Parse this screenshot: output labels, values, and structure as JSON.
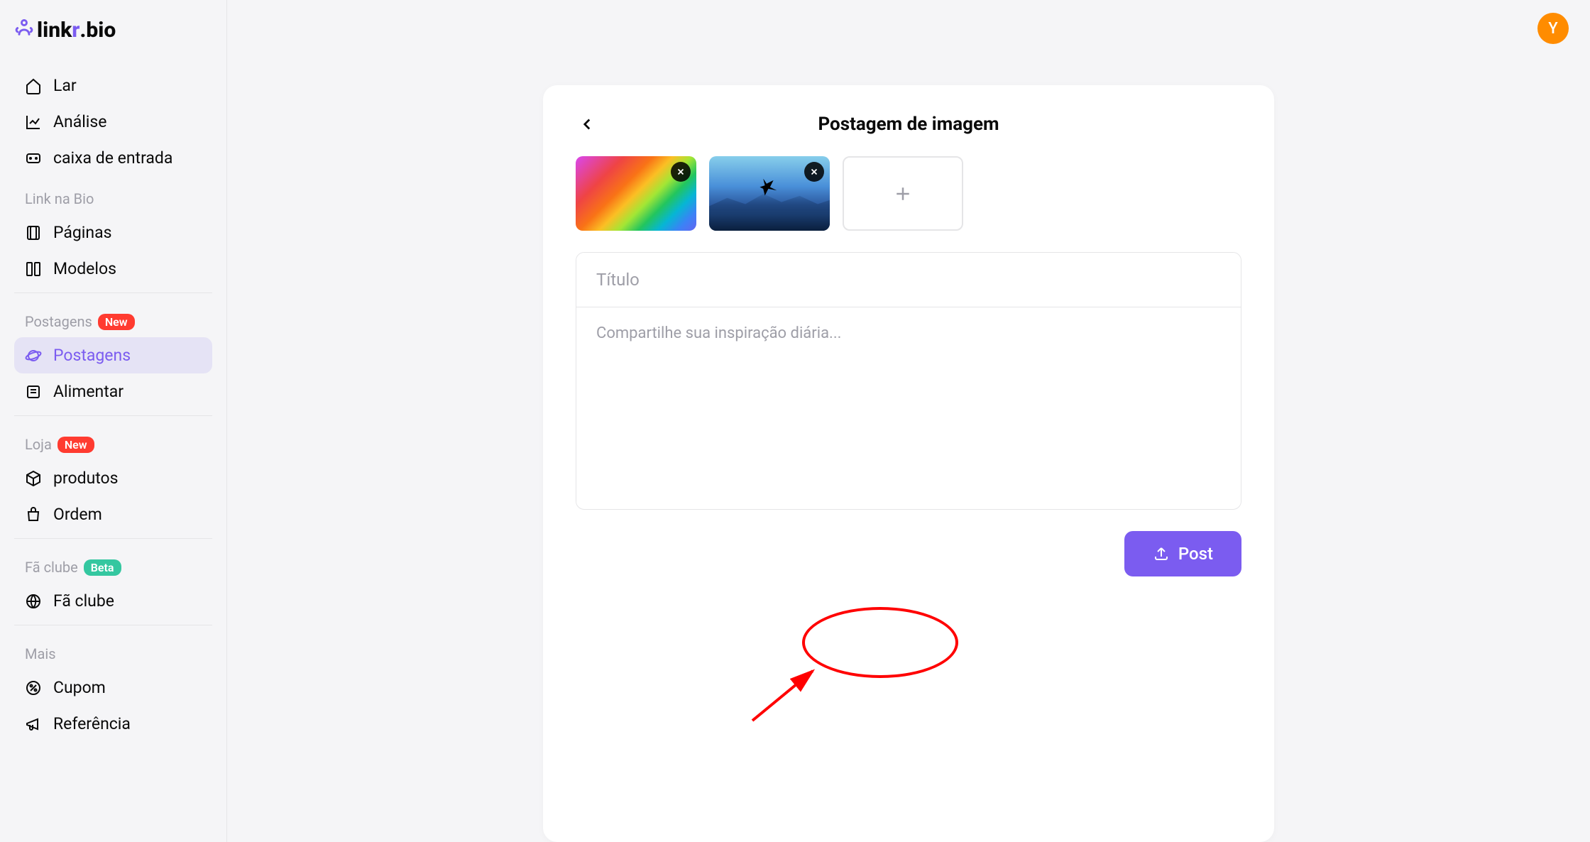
{
  "logo": {
    "text_black1": "link",
    "text_purple": "r",
    "text_black2": ".bio"
  },
  "avatar": {
    "initial": "Y"
  },
  "sidebar": {
    "top": [
      {
        "label": "Lar",
        "icon": "home"
      },
      {
        "label": "Análise",
        "icon": "chart"
      },
      {
        "label": "caixa de entrada",
        "icon": "inbox"
      }
    ],
    "sections": [
      {
        "title": "Link na Bio",
        "badge": null,
        "items": [
          {
            "label": "Páginas",
            "icon": "pages"
          },
          {
            "label": "Modelos",
            "icon": "models"
          }
        ]
      },
      {
        "title": "Postagens",
        "badge": "New",
        "badge_type": "new",
        "items": [
          {
            "label": "Postagens",
            "icon": "planet",
            "active": true
          },
          {
            "label": "Alimentar",
            "icon": "feed"
          }
        ]
      },
      {
        "title": "Loja",
        "badge": "New",
        "badge_type": "new",
        "items": [
          {
            "label": "produtos",
            "icon": "box"
          },
          {
            "label": "Ordem",
            "icon": "bag"
          }
        ]
      },
      {
        "title": "Fã clube",
        "badge": "Beta",
        "badge_type": "beta",
        "items": [
          {
            "label": "Fã clube",
            "icon": "globe"
          }
        ]
      },
      {
        "title": "Mais",
        "badge": null,
        "items": [
          {
            "label": "Cupom",
            "icon": "percent"
          },
          {
            "label": "Referência",
            "icon": "megaphone"
          }
        ]
      }
    ]
  },
  "card": {
    "title": "Postagem de imagem",
    "title_placeholder": "Título",
    "content_placeholder": "Compartilhe sua inspiração diária...",
    "post_button": "Post"
  }
}
